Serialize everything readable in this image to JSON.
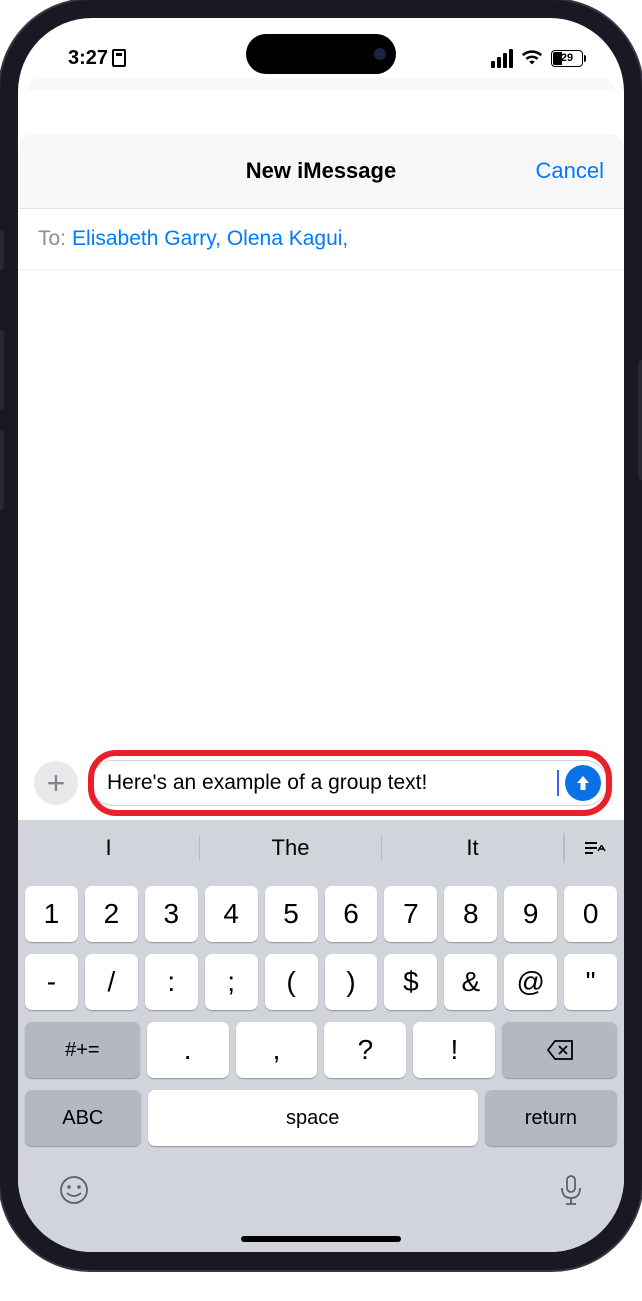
{
  "status": {
    "time": "3:27",
    "battery_pct": "29"
  },
  "nav": {
    "title": "New iMessage",
    "cancel": "Cancel"
  },
  "to": {
    "label": "To:",
    "recipients": "Elisabeth Garry, Olena Kagui,"
  },
  "compose": {
    "text": "Here's an example of a group text!"
  },
  "suggestions": {
    "s1": "I",
    "s2": "The",
    "s3": "It"
  },
  "keys": {
    "row1": [
      "1",
      "2",
      "3",
      "4",
      "5",
      "6",
      "7",
      "8",
      "9",
      "0"
    ],
    "row2": [
      "-",
      "/",
      ":",
      ";",
      "(",
      ")",
      "$",
      "&",
      "@",
      "\""
    ],
    "shift": "#+=",
    "row3": [
      ".",
      ",",
      "?",
      "!"
    ],
    "abc": "ABC",
    "space": "space",
    "return": "return"
  }
}
